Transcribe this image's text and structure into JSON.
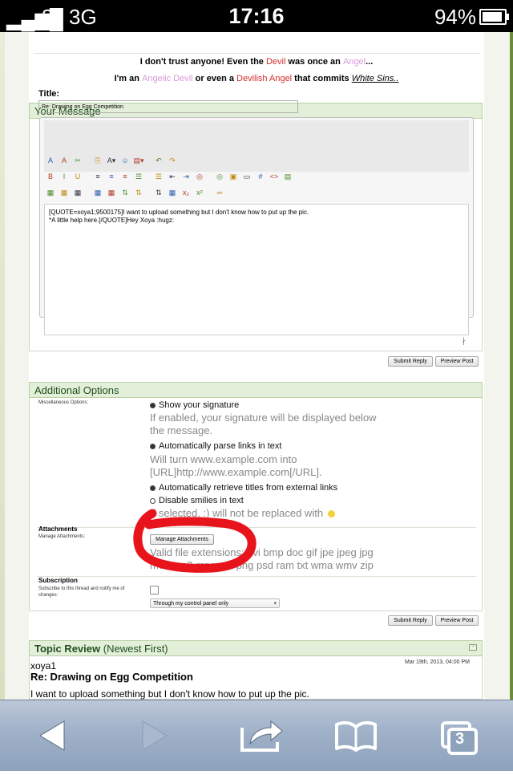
{
  "status_bar": {
    "signal": "▂▄▆█",
    "carrier": "3",
    "network": "3G",
    "time": "17:16",
    "battery": "94%"
  },
  "signature": {
    "line1_a": "I don't trust anyone! Even the ",
    "line1_devil": "Devil",
    "line1_b": " was once an ",
    "line1_angel": "Angel",
    "line1_c": "...",
    "line2_a": "I'm an ",
    "line2_angelic": "Angelic Devil",
    "line2_b": " or even a ",
    "line2_devilish": "Devilish Angel",
    "line2_c": " that commits ",
    "line2_white": "White Sins.."
  },
  "your_message": {
    "header": "Your Message",
    "title_label": "Title:",
    "title_value": "Re: Drawing on Egg Competition",
    "message_line1": "[QUOTE=xoya1;9500175]I want to upload something but I don't know how to put up the pic.",
    "message_line2": "*A little help here.[/QUOTE]Hey Xoya :hugz:",
    "submit_label": "Submit Reply",
    "preview_label": "Preview Post"
  },
  "toolbar": {
    "row1": [
      "A",
      "A",
      "✂",
      "⎘",
      "A▾",
      "☺",
      "▤▾",
      "↶",
      "↷"
    ],
    "row2": [
      "B",
      "I",
      "U",
      "≡",
      "≡",
      "≡",
      "☰",
      "☰",
      "⇤",
      "⇥",
      "◎",
      "◎",
      "▣",
      "▭",
      "#",
      "<>",
      "▤"
    ],
    "row3": [
      "▦",
      "▦",
      "▦",
      "▦",
      "▦",
      "⇅",
      "⇅",
      "⇅",
      "▦",
      "x₂",
      "x²",
      "═"
    ]
  },
  "additional_options": {
    "header": "Additional Options",
    "misc_label": "Miscellaneous Options:",
    "options": [
      {
        "label": "Show your signature",
        "desc_1": "If enabled, your signature will be displayed below",
        "desc_2": "the message.",
        "checked": true
      },
      {
        "label": "Automatically parse links in text",
        "desc_1": "Will turn www.example.com into",
        "desc_2": "[URL]http://www.example.com[/URL].",
        "checked": true
      },
      {
        "label": "Automatically retrieve titles from external links",
        "checked": true
      },
      {
        "label": "Disable smilies in text",
        "desc_1": "If selected, :) will not be replaced with",
        "checked": false
      }
    ],
    "attachments_title": "Attachments",
    "manage_label": "Manage Attachments:",
    "manage_button": "Manage Attachments",
    "valid_ext_1": "Valid file extensions: avi bmp doc gif jpe jpeg jpg",
    "valid_ext_2": "mov mp3 mpg pdf png psd ram txt wma wmv zip",
    "subscription_title": "Subscription",
    "subscription_label_1": "Subscribe to this thread and notify me of",
    "subscription_label_2": "changes:",
    "subscription_select": "Through my control panel only",
    "submit_label": "Submit Reply",
    "preview_label": "Preview Post"
  },
  "topic_review": {
    "header": "Topic Review",
    "header_sub": "(Newest First)",
    "user": "xoya1",
    "date": "Mar 19th, 2013, 04:00 PM",
    "post_title": "Re: Drawing on Egg Competition",
    "post_text": "I want to upload something but I don't know how to put up the pic."
  },
  "tab_bar": {
    "tab_count": "3"
  },
  "colors": {
    "annotation": "#e8141c",
    "panel_header_bg": "#e3efd8",
    "panel_header_text": "#1f4e1f",
    "devil": "#d62c2c",
    "angel": "#d99ad9"
  }
}
